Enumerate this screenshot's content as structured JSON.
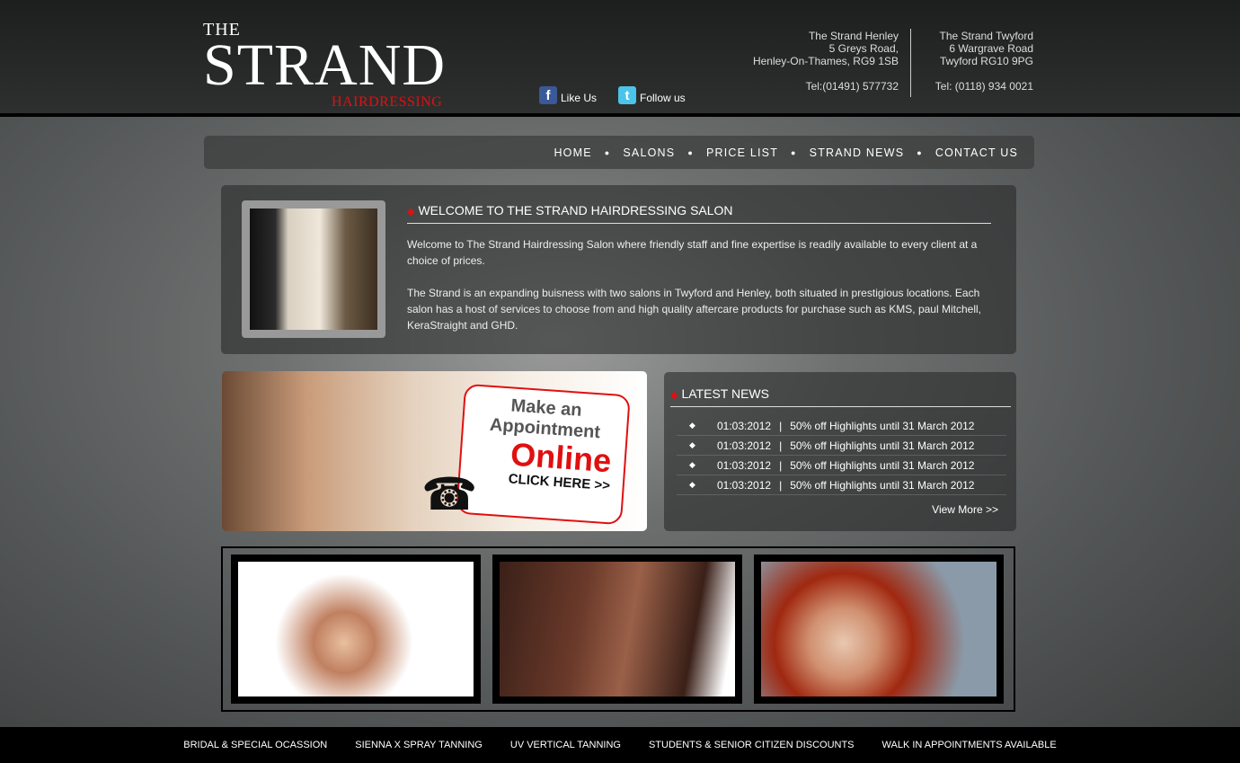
{
  "logo": {
    "the": "THE",
    "strand": "STRAND",
    "hairdressing": "HAIRDRESSING"
  },
  "social": {
    "facebook": "Like Us",
    "twitter": "Follow us"
  },
  "salons": [
    {
      "name": "The Strand Henley",
      "line1": "5 Greys Road,",
      "line2": "Henley-On-Thames, RG9 1SB",
      "tel": "Tel:(01491) 577732"
    },
    {
      "name": "The Strand Twyford",
      "line1": "6 Wargrave Road",
      "line2": "Twyford RG10 9PG",
      "tel": "Tel: (0118) 934 0021"
    }
  ],
  "nav": [
    "HOME",
    "SALONS",
    "PRICE LIST",
    "STRAND NEWS",
    "CONTACT US"
  ],
  "welcome": {
    "title": "WELCOME TO THE STRAND HAIRDRESSING SALON",
    "p1": "Welcome to The Strand Hairdressing Salon where friendly staff and fine expertise is readily available to every client at a choice of prices.",
    "p2": "The Strand is an expanding buisness with two salons in Twyford and Henley, both situated in prestigious locations. Each salon has a host of services to choose from and high quality aftercare products for purchase such as KMS, paul Mitchell, KeraStraight and GHD."
  },
  "appointment": {
    "line1": "Make an",
    "line2": "Appointment",
    "line3": "Online",
    "cta": "CLICK HERE >>"
  },
  "news": {
    "title": "LATEST NEWS",
    "items": [
      {
        "date": "01:03:2012",
        "text": "50% off Highlights until 31 March 2012"
      },
      {
        "date": "01:03:2012",
        "text": "50% off Highlights until 31 March 2012"
      },
      {
        "date": "01:03:2012",
        "text": "50% off Highlights until 31 March 2012"
      },
      {
        "date": "01:03:2012",
        "text": "50% off Highlights until 31 March 2012"
      }
    ],
    "more": "View More >>"
  },
  "footer": [
    "BRIDAL & SPECIAL OCASSION",
    "SIENNA X SPRAY TANNING",
    "UV VERTICAL TANNING",
    "STUDENTS & SENIOR CITIZEN DISCOUNTS",
    "WALK IN APPOINTMENTS AVAILABLE"
  ]
}
